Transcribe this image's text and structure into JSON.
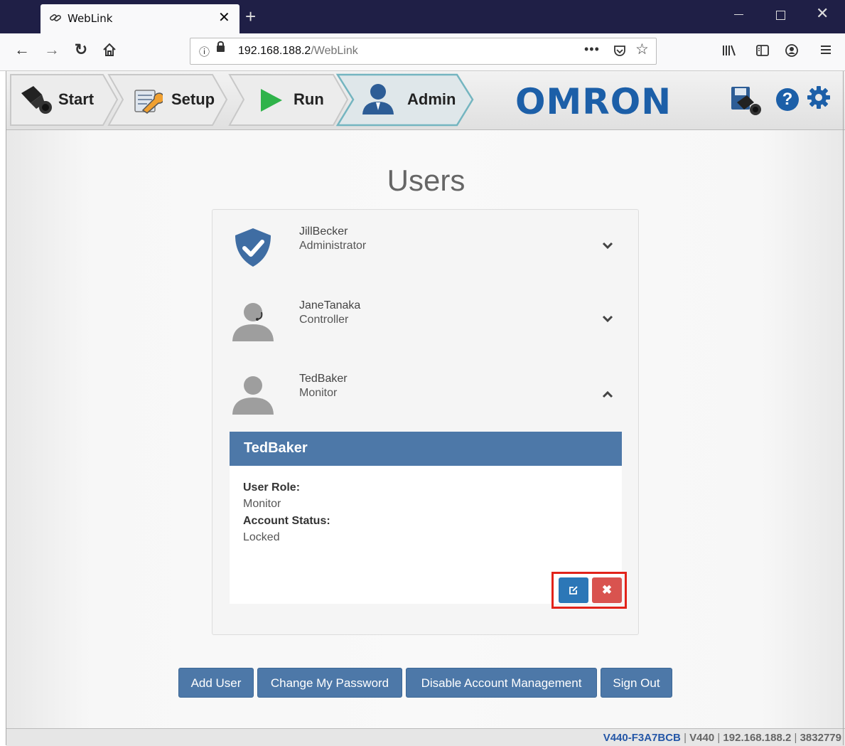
{
  "browser": {
    "tab_title": "WebLink",
    "url_host": "192.168.188.2",
    "url_path": "/WebLink",
    "new_tab": "+",
    "more": "•••"
  },
  "toolbar": {
    "steps": [
      {
        "label": "Start"
      },
      {
        "label": "Setup"
      },
      {
        "label": "Run"
      },
      {
        "label": "Admin",
        "active": true
      }
    ],
    "brand": "OMRON"
  },
  "main": {
    "title": "Users",
    "users": [
      {
        "name": "JillBecker",
        "role": "Administrator",
        "expanded": false
      },
      {
        "name": "JaneTanaka",
        "role": "Controller",
        "expanded": false
      },
      {
        "name": "TedBaker",
        "role": "Monitor",
        "expanded": true
      }
    ],
    "detail": {
      "name": "TedBaker",
      "role_label": "User Role:",
      "role_value": "Monitor",
      "status_label": "Account Status:",
      "status_value": "Locked"
    },
    "actions": {
      "add_user": "Add User",
      "change_password": "Change My Password",
      "disable_account_mgmt": "Disable Account Management",
      "sign_out": "Sign Out"
    }
  },
  "status_bar": {
    "device_id": "V440-F3A7BCB",
    "sep1": " | ",
    "model": "V440",
    "sep2": " | ",
    "ip": "192.168.188.2",
    "sep3": " | ",
    "code": "3832779"
  },
  "colors": {
    "accent": "#4d78a8",
    "brand": "#1c5fa8",
    "danger": "#d9534f",
    "highlight": "#e2231a"
  }
}
